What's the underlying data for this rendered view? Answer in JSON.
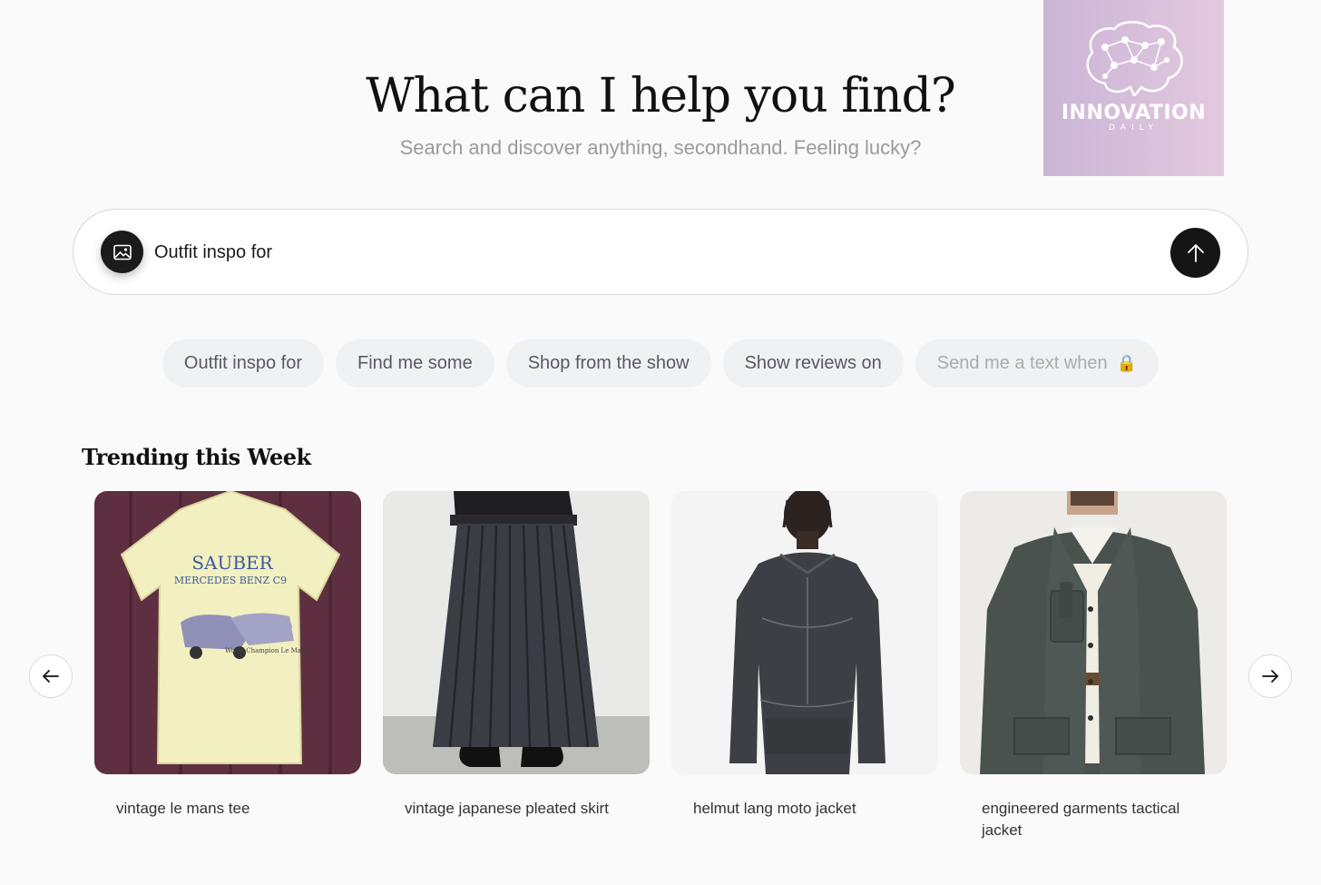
{
  "logo": {
    "word": "INNOVATION",
    "sub": "DAILY",
    "bg_from": "#cbb5d6",
    "bg_to": "#e3c9df"
  },
  "hero": {
    "title": "What can I help you find?",
    "subtitle": "Search and discover anything, secondhand. Feeling lucky?"
  },
  "search": {
    "value": "Outfit inspo for",
    "image_icon": "image-icon",
    "send_icon": "arrow-up-icon"
  },
  "chips": [
    {
      "label": "Outfit inspo for",
      "locked": false
    },
    {
      "label": "Find me some",
      "locked": false
    },
    {
      "label": "Shop from the show",
      "locked": false
    },
    {
      "label": "Show reviews on",
      "locked": false
    },
    {
      "label": "Send me a text when",
      "locked": true,
      "icon": "🔒"
    }
  ],
  "trending": {
    "title": "Trending this Week",
    "prev_icon": "arrow-left-icon",
    "next_icon": "arrow-right-icon",
    "items": [
      {
        "label": "vintage le mans tee",
        "print_text": "SAUBER",
        "print_sub": "MERCEDES BENZ C9",
        "print_caption": "World Champion Le Mans"
      },
      {
        "label": "vintage japanese pleated skirt"
      },
      {
        "label": "helmut lang moto jacket"
      },
      {
        "label": "engineered garments tactical jacket"
      }
    ]
  },
  "colors": {
    "accent": "#151515",
    "chip_bg": "#f0f1f3",
    "page_bg": "#fafafa"
  }
}
